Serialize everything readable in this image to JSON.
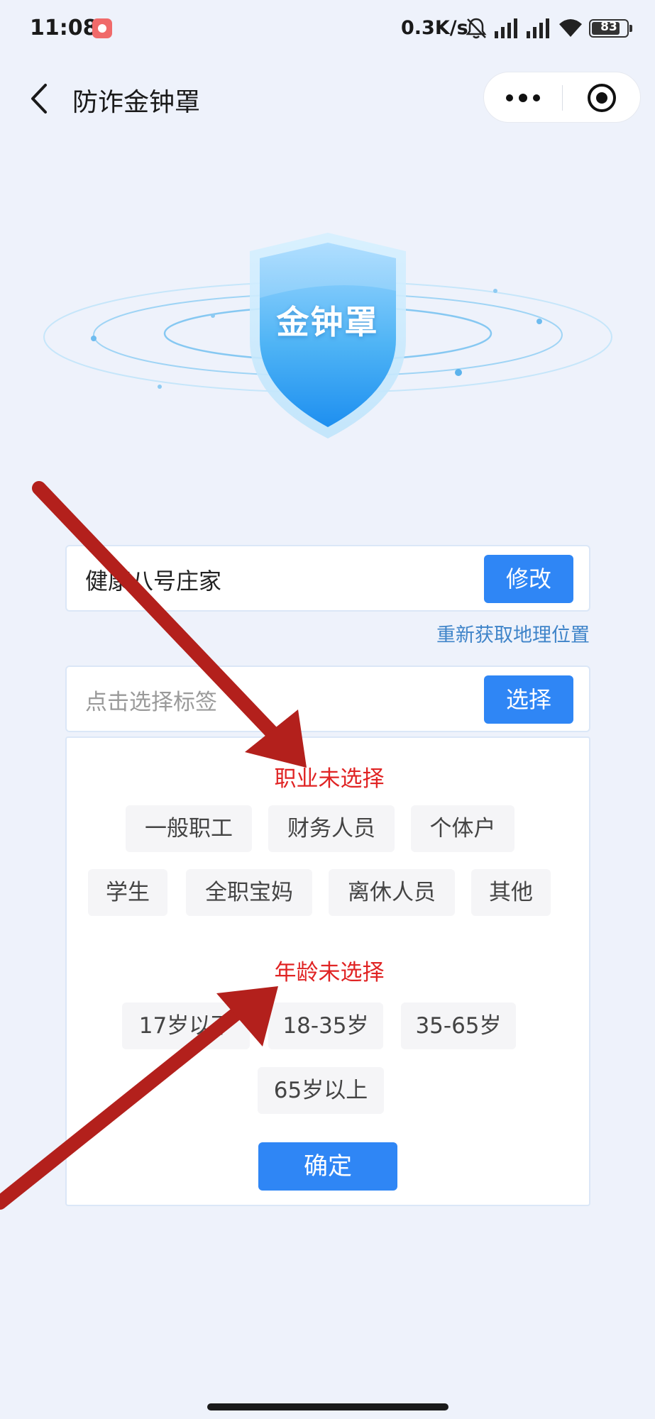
{
  "status_bar": {
    "time": "11:08",
    "net_speed": "0.3K/s",
    "battery": 83
  },
  "nav": {
    "title": "防诈金钟罩"
  },
  "hero": {
    "shield_text": "金钟罩"
  },
  "address": {
    "value": "健康八号庄家",
    "modify_label": "修改",
    "relocate_label": "重新获取地理位置"
  },
  "tag": {
    "placeholder": "点击选择标签",
    "select_label": "选择"
  },
  "occupation": {
    "title": "职业未选择",
    "options": [
      "一般职工",
      "财务人员",
      "个体户",
      "学生",
      "全职宝妈",
      "离休人员",
      "其他"
    ]
  },
  "age": {
    "title": "年龄未选择",
    "options": [
      "17岁以下",
      "18-35岁",
      "35-65岁",
      "65岁以上"
    ]
  },
  "confirm_label": "确定",
  "colors": {
    "primary": "#2f86f5",
    "alert": "#e02424",
    "annotation_arrow": "#b3201c",
    "link": "#3f84c9"
  }
}
